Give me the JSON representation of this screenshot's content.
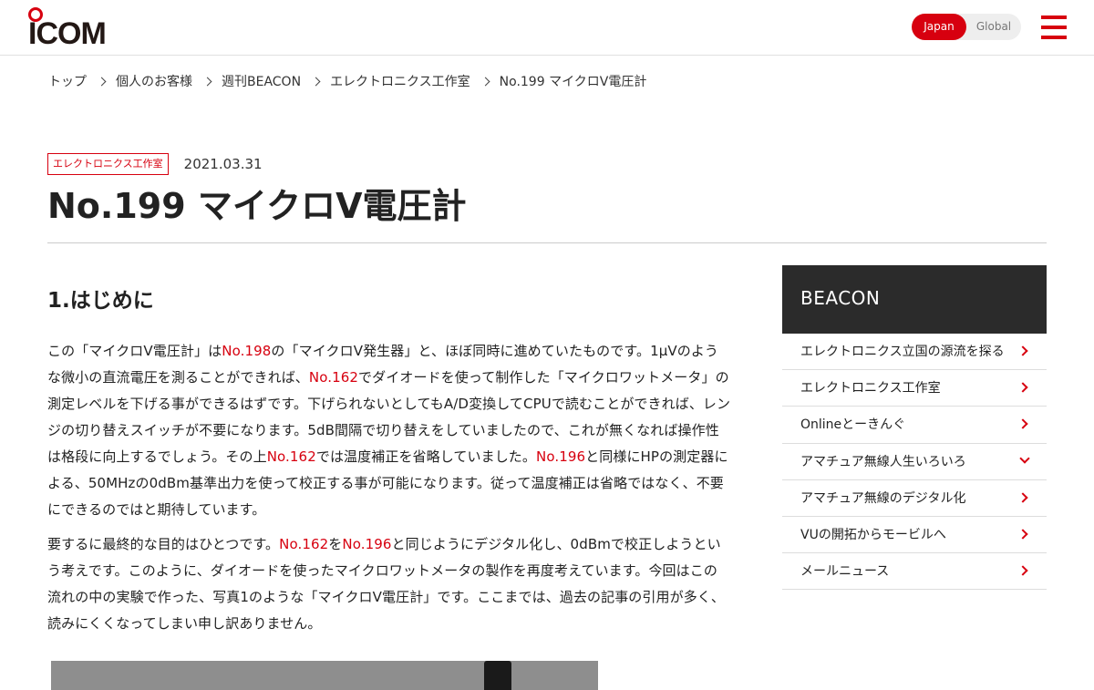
{
  "header": {
    "logo_text": "ICOM",
    "region": {
      "japan": "Japan",
      "global": "Global",
      "selected": "Japan"
    },
    "accent_color": "#d7000f"
  },
  "breadcrumb": [
    "トップ",
    "個人のお客様",
    "週刊BEACON",
    "エレクトロニクス工作室",
    "No.199 マイクロV電圧計"
  ],
  "article": {
    "category": "エレクトロニクス工作室",
    "date": "2021.03.31",
    "title": "No.199 マイクロV電圧計",
    "section_heading": "1.はじめに",
    "p1": {
      "s1": "この「マイクロV電圧計」は",
      "link1": "No.198",
      "s2": "の「マイクロV発生器」と、ほぼ同時に進めていたものです。1μVのような微小の直流電圧を測ることができれば、",
      "link2": "No.162",
      "s3": "でダイオードを使って制作した「マイクロワットメータ」の測定レベルを下げる事ができるはずです。下げられないとしてもA/D変換してCPUで読むことができれば、レンジの切り替えスイッチが不要になります。5dB間隔で切り替えをしていましたので、これが無くなれば操作性は格段に向上するでしょう。その上",
      "link3": "No.162",
      "s4": "では温度補正を省略していました。",
      "link4": "No.196",
      "s5": "と同様にHPの測定器による、50MHzの0dBm基準出力を使って校正する事が可能になります。従って温度補正は省略ではなく、不要にできるのではと期待しています。"
    },
    "p2": {
      "s1": "要するに最終的な目的はひとつです。",
      "link1": "No.162",
      "s2": "を",
      "link2": "No.196",
      "s3": "と同じようにデジタル化し、0dBmで校正しようという考えです。このように、ダイオードを使ったマイクロワットメータの製作を再度考えています。今回はこの流れの中の実験で作った、写真1のような「マイクロV電圧計」です。ここまでは、過去の記事の引用が多く、読みにくくなってしまい申し訳ありません。"
    }
  },
  "sidebar": {
    "title": "BEACON",
    "items": [
      {
        "label": "エレクトロニクス立国の源流を探る",
        "icon": "chevron-right-icon"
      },
      {
        "label": "エレクトロニクス工作室",
        "icon": "chevron-right-icon"
      },
      {
        "label": "Onlineとーきんぐ",
        "icon": "chevron-right-icon"
      },
      {
        "label": "アマチュア無線人生いろいろ",
        "icon": "chevron-down-icon"
      },
      {
        "label": "アマチュア無線のデジタル化",
        "icon": "chevron-right-icon"
      },
      {
        "label": "VUの開拓からモービルへ",
        "icon": "chevron-right-icon"
      },
      {
        "label": "メールニュース",
        "icon": "chevron-right-icon"
      }
    ]
  }
}
